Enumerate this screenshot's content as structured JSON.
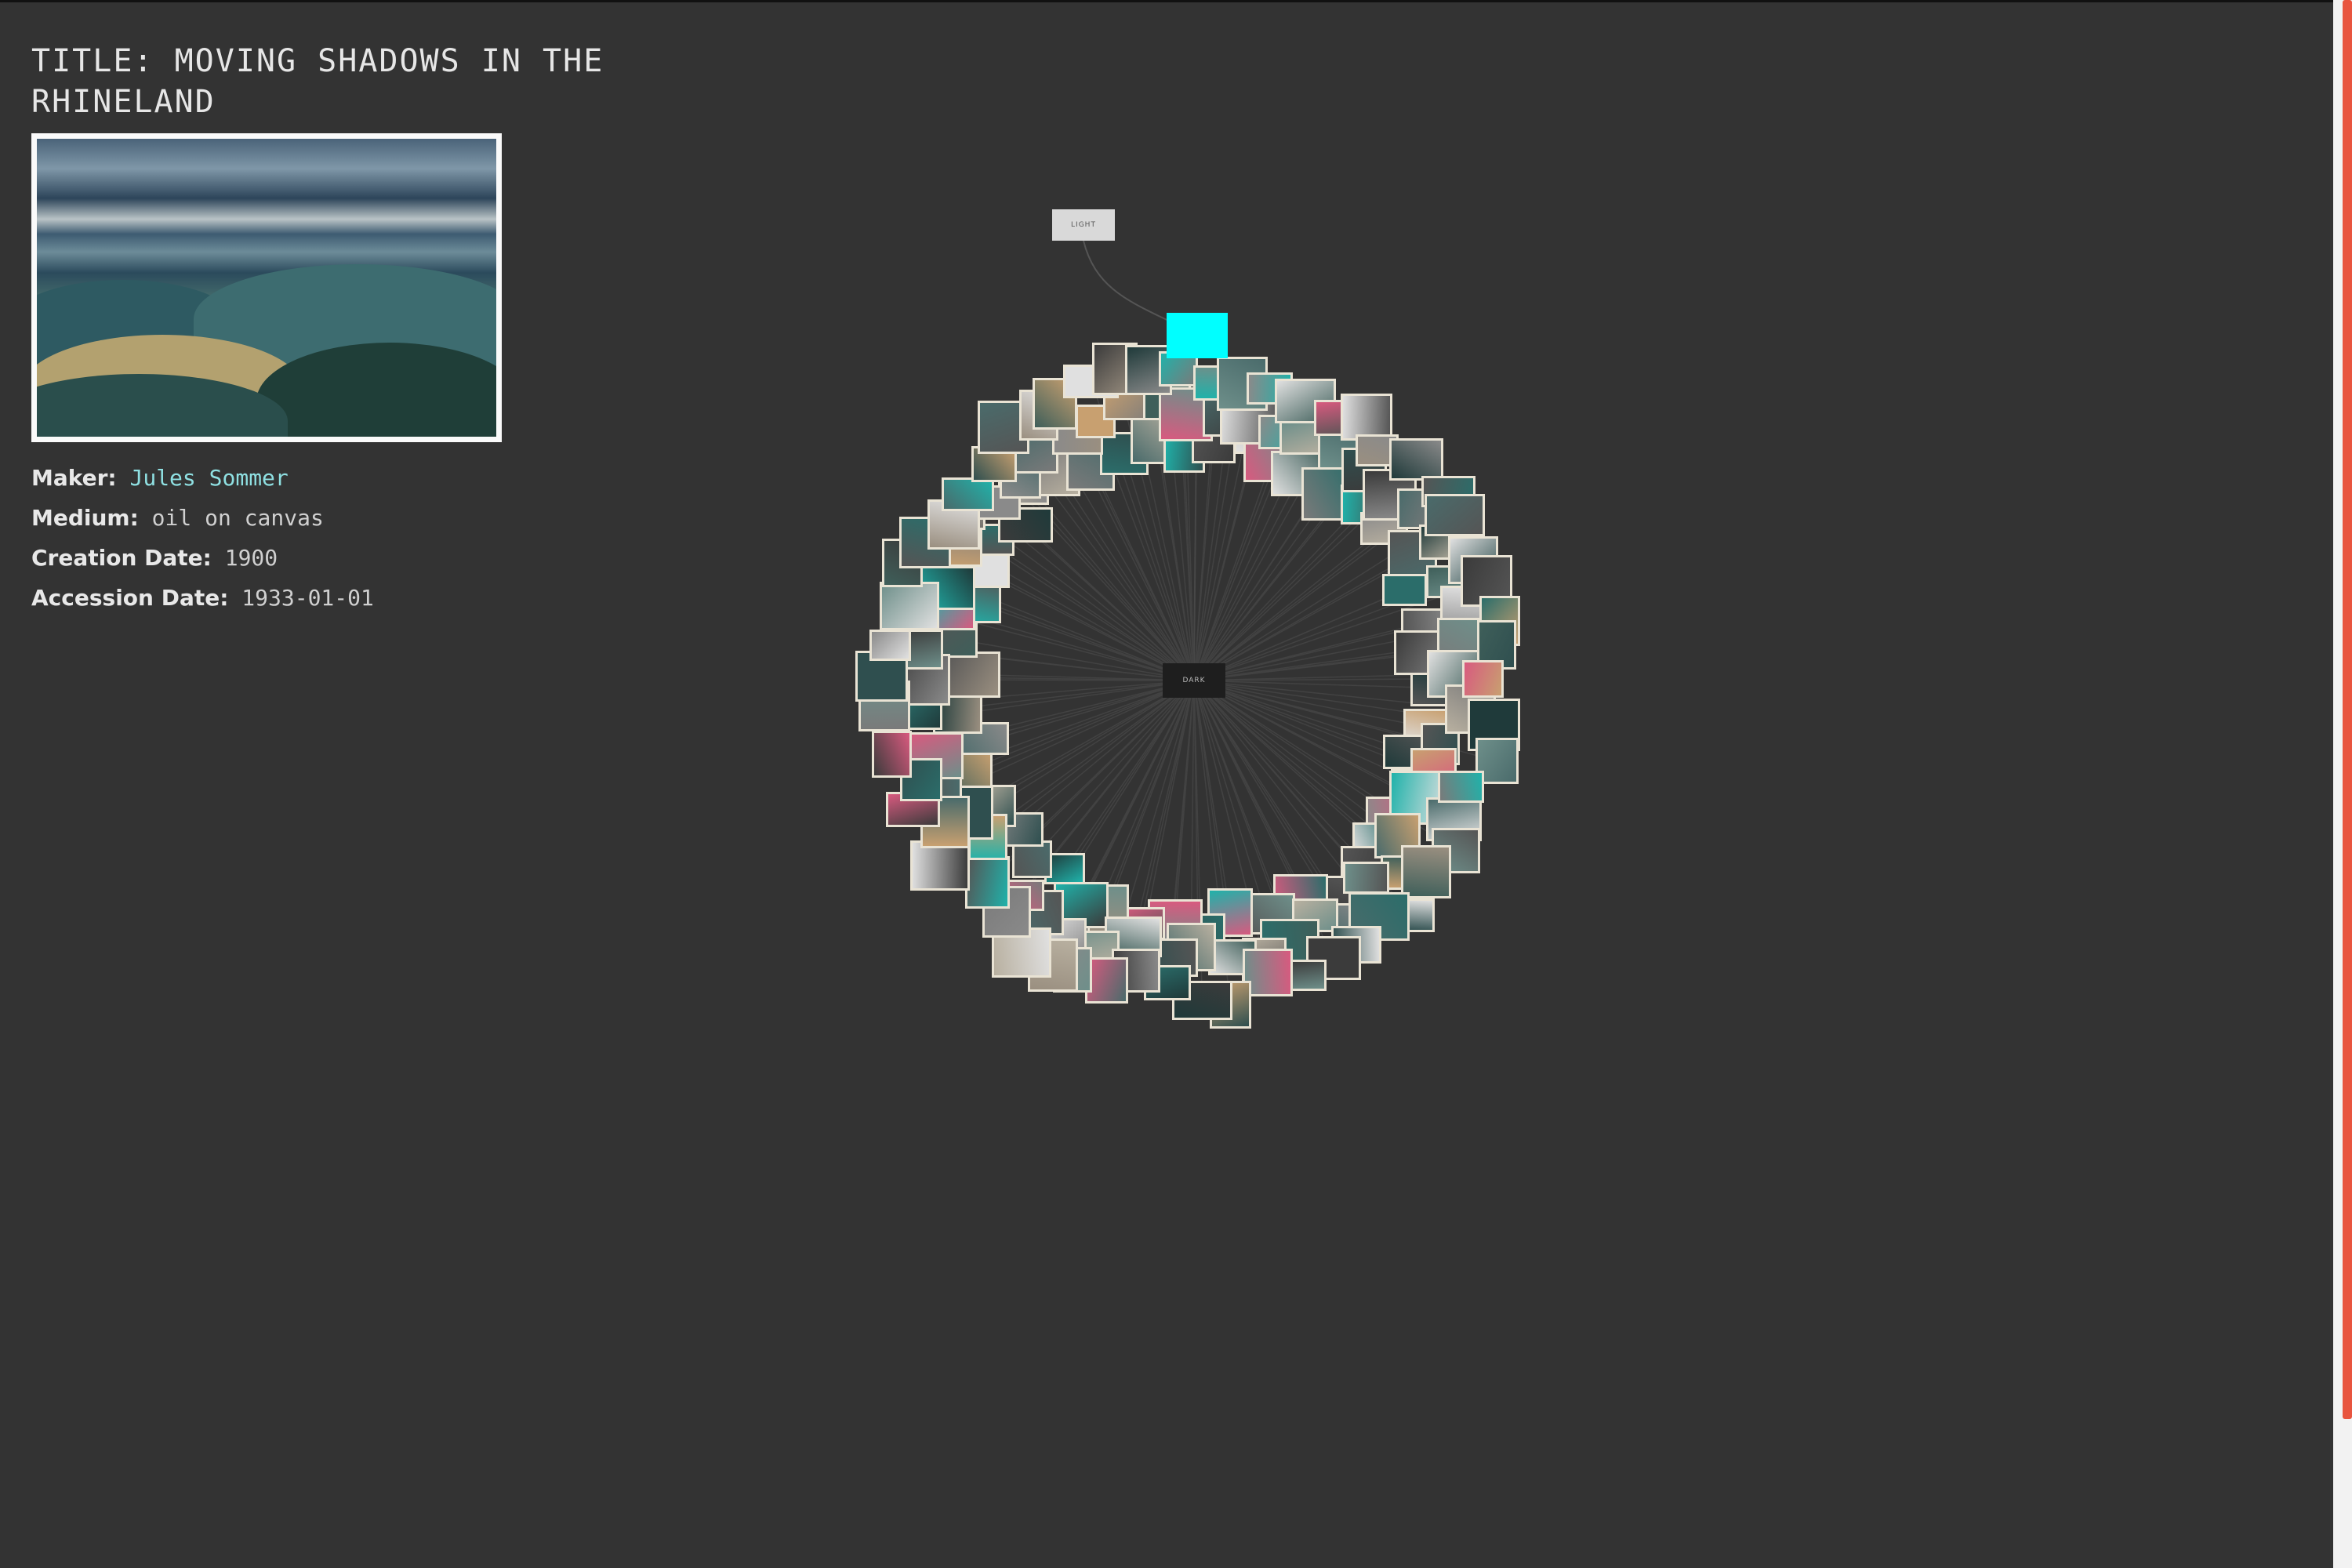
{
  "artwork": {
    "title": "TITLE: MOVING SHADOWS IN THE RHINELAND",
    "image_alt": "Painting of rolling green mountains under a cloudy sky",
    "maker_label": "Maker:",
    "maker_value": "Jules Sommer",
    "medium_label": "Medium:",
    "medium_value": "oil on canvas",
    "creation_label": "Creation Date:",
    "creation_value": "1900",
    "accession_label": "Accession Date:",
    "accession_value": "1933-01-01"
  },
  "graph": {
    "light_label": "LIGHT",
    "dark_label": "DARK",
    "highlight_color": "#00ffff",
    "thumbnail_palette": [
      "#2f4f4f",
      "#4a6b6b",
      "#8a8a8a",
      "#3b3b3b",
      "#6e8f8a",
      "#2b6d6a",
      "#b8b0a0",
      "#555555",
      "#1f3a3a",
      "#7a7a7a",
      "#c8a070",
      "#3f5f5a",
      "#e0e0e0",
      "#20b2aa",
      "#9a8f80",
      "#d85a7f"
    ]
  },
  "colors": {
    "background": "#333333",
    "link": "#8fe0e2",
    "scroll_thumb": "#e8553f"
  }
}
